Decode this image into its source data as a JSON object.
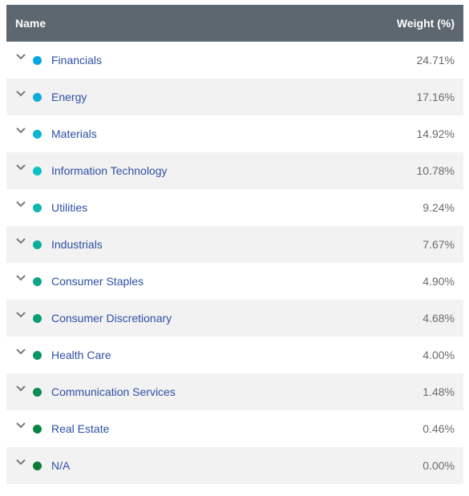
{
  "header": {
    "name_label": "Name",
    "weight_label": "Weight (%)"
  },
  "rows": [
    {
      "name": "Financials",
      "weight": "24.71%",
      "color": "#0aa5e0"
    },
    {
      "name": "Energy",
      "weight": "17.16%",
      "color": "#0badd8"
    },
    {
      "name": "Materials",
      "weight": "14.92%",
      "color": "#0bb7cf"
    },
    {
      "name": "Information Technology",
      "weight": "10.78%",
      "color": "#0cc0c6"
    },
    {
      "name": "Utilities",
      "weight": "9.24%",
      "color": "#0db8b0"
    },
    {
      "name": "Industrials",
      "weight": "7.67%",
      "color": "#0cae98"
    },
    {
      "name": "Consumer Staples",
      "weight": "4.90%",
      "color": "#0ba588"
    },
    {
      "name": "Consumer Discretionary",
      "weight": "4.68%",
      "color": "#0b9e78"
    },
    {
      "name": "Health Care",
      "weight": "4.00%",
      "color": "#0a9565"
    },
    {
      "name": "Communication Services",
      "weight": "1.48%",
      "color": "#0a8c52"
    },
    {
      "name": "Real Estate",
      "weight": "0.46%",
      "color": "#0a8343"
    },
    {
      "name": "N/A",
      "weight": "0.00%",
      "color": "#0b7a35"
    }
  ]
}
